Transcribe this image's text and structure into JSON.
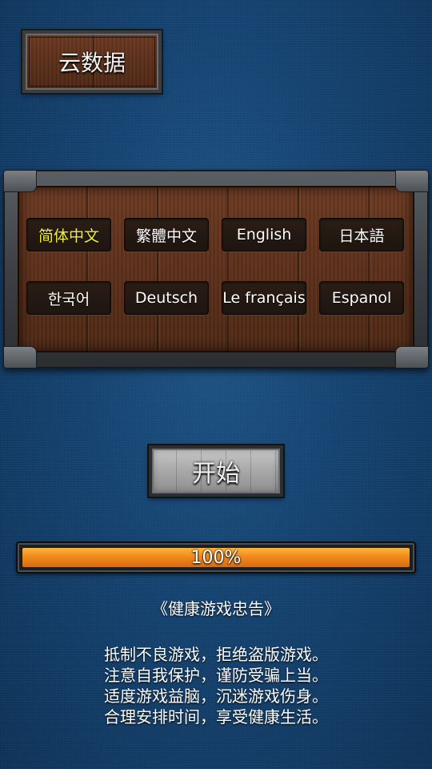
{
  "cloud_button": {
    "label": "云数据"
  },
  "languages": {
    "selected_index": 0,
    "items": [
      {
        "label": "简体中文"
      },
      {
        "label": "繁體中文"
      },
      {
        "label": "English"
      },
      {
        "label": "日本語"
      },
      {
        "label": "한국어"
      },
      {
        "label": "Deutsch"
      },
      {
        "label": "Le français"
      },
      {
        "label": "Espanol"
      }
    ]
  },
  "start_button": {
    "label": "开始"
  },
  "progress": {
    "value": 1.0,
    "label": "100%"
  },
  "advisory": {
    "title": "《健康游戏忠告》",
    "lines": [
      "抵制不良游戏，拒绝盗版游戏。",
      "注意自我保护，谨防受骗上当。",
      "适度游戏益脑，沉迷游戏伤身。",
      "合理安排时间，享受健康生活。"
    ]
  },
  "colors": {
    "background": "#154472",
    "selected_language": "#f2f03a",
    "progress_fill": "#f08a1c"
  }
}
